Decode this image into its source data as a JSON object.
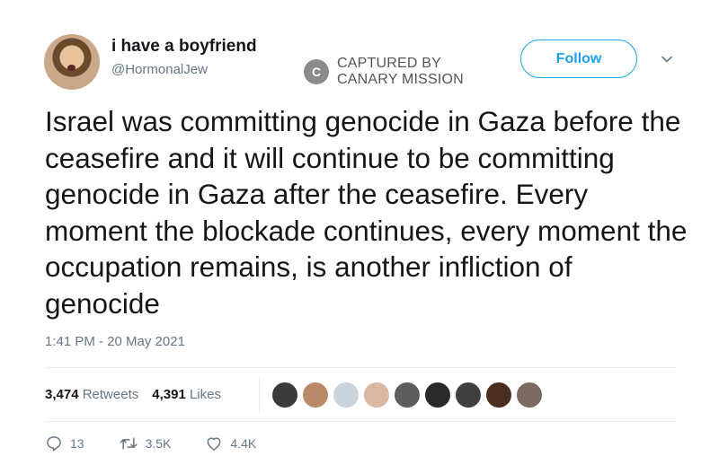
{
  "author": {
    "display_name": "i have a boyfriend",
    "handle": "@HormonalJew"
  },
  "watermark": {
    "logo_letter": "C",
    "line1": "CAPTURED BY",
    "line2": "CANARY MISSION"
  },
  "follow_label": "Follow",
  "tweet": {
    "text": "Israel was committing genocide in Gaza before the ceasefire and it will continue to be committing genocide in Gaza after the ceasefire. Every moment the blockade continues, every moment the occupation remains, is another infliction of genocide",
    "timestamp": "1:41 PM - 20 May 2021"
  },
  "stats": {
    "retweets_count": "3,474",
    "retweets_label": "Retweets",
    "likes_count": "4,391",
    "likes_label": "Likes"
  },
  "likers": [
    {
      "name": "liker-avatar",
      "color": "#3b3b3b"
    },
    {
      "name": "liker-avatar",
      "color": "#b98a6a"
    },
    {
      "name": "liker-avatar-default",
      "color": "#c8d3dc"
    },
    {
      "name": "liker-avatar",
      "color": "#d9b8a3"
    },
    {
      "name": "liker-avatar",
      "color": "#5d5d5d"
    },
    {
      "name": "liker-avatar",
      "color": "#2a2a2a"
    },
    {
      "name": "liker-avatar",
      "color": "#3f3f3f"
    },
    {
      "name": "liker-avatar",
      "color": "#4a2e22"
    },
    {
      "name": "liker-avatar",
      "color": "#7a6a60"
    }
  ],
  "actions": {
    "replies": "13",
    "retweets": "3.5K",
    "likes": "4.4K"
  },
  "colors": {
    "accent": "#1da1f2",
    "secondary_text": "#657786",
    "primary_text": "#14171a"
  }
}
